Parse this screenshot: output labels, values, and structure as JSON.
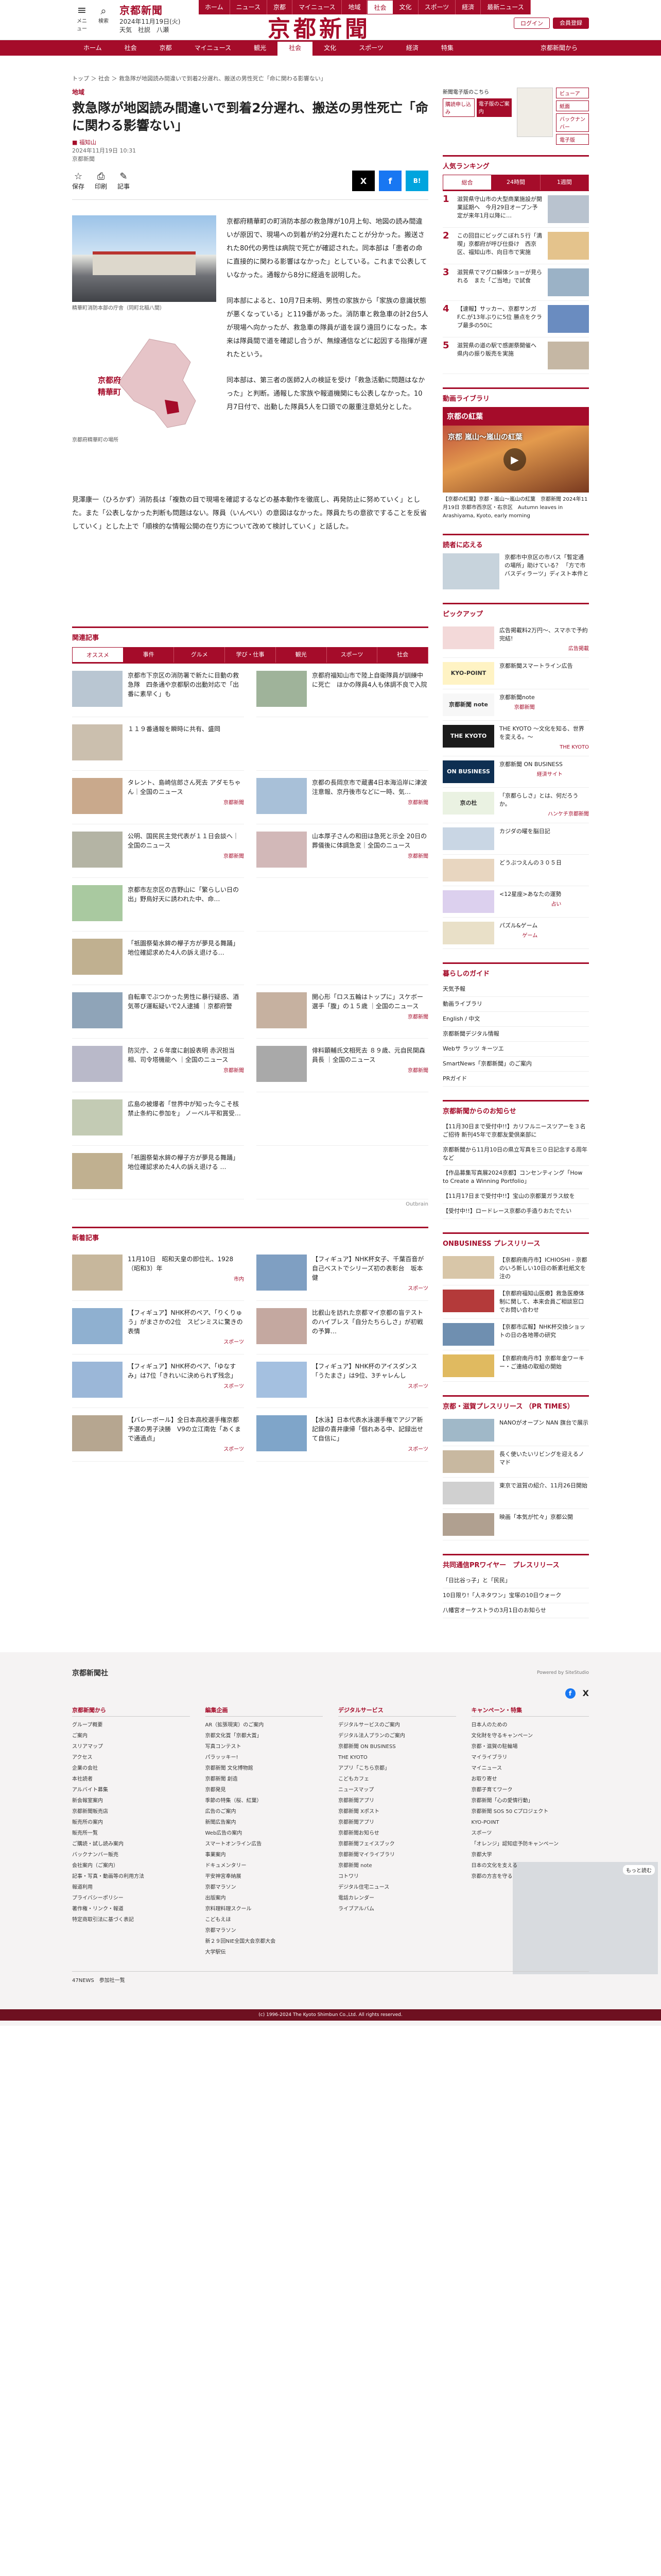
{
  "header": {
    "menu_label": "メニュー",
    "search_label": "検索",
    "small_logo": "京都新聞",
    "date": "2024年11月19日(火)",
    "weather": "天気　社説　八瀬",
    "big_logo": "京都新聞",
    "top_tabs": [
      "ホーム",
      "ニュース",
      "京都",
      "マイニュース",
      "地域",
      "社会",
      "文化",
      "スポーツ",
      "経済",
      "最新ニュース"
    ],
    "active_top_tab": "社会",
    "login": "ログイン",
    "register": "会員登録",
    "newsletter": "京都新聞から"
  },
  "nav2": [
    "ホーム",
    "社会",
    "京都",
    "マイニュース",
    "観光",
    "社会",
    "文化",
    "スポーツ",
    "経済",
    "特集"
  ],
  "nav2_active": "社会",
  "nav2_right": "京都新聞から",
  "breadcrumb": "トップ ＞ 社会 ＞ 救急隊が地図読み間違いで到着2分遅れ、搬送の男性死亡「命に関わる影響ない」",
  "article": {
    "category": "地域",
    "title": "救急隊が地図読み間違いで到着2分遅れ、搬送の男性死亡「命に関わる影響ない」",
    "writer": "■ 福知山",
    "date": "2024年11月19日 10:31",
    "source": "京都新聞",
    "tools": [
      "保存",
      "印刷",
      "記事"
    ],
    "share": [
      "X",
      "f",
      "B!"
    ],
    "photo_caption": "精華町消防本部の庁舎（同町北稲八間）",
    "map_label1": "京都府",
    "map_label2": "精華町",
    "map_caption": "京都府精華町の場所",
    "p1": "京都府精華町の町消防本部の救急隊が10月上旬、地図の読み間違いが原因で、現場への到着が約2分遅れたことが分かった。搬送された80代の男性は病院で死亡が確認された。同本部は「患者の命に直接的に関わる影響はなかった」としている。これまで公表していなかった。通報から8分に経過を説明した。",
    "p2": "同本部によると、10月7日未明、男性の家族から「家族の意識状態が悪くなっている」と119番があった。消防車と救急車の計2台5人が現場へ向かったが、救急車の隊員が道を誤り遠回りになった。本来は隊員間で道を確認し合うが、無線通信などに起因する指揮が遅れたという。",
    "p3": "同本部は、第三者の医師2人の検証を受け「救急活動に問題はなかった」と判断。通報した家族や報道機関にも公表しなかった。10月7日付で、出動した隊員5人を口頭での厳重注意処分とした。",
    "p4": "見澤康一（ひろかず）消防長は「複数の目で現場を確認するなどの基本動作を徹底し、再発防止に努めていく」とした。また「公表しなかった判断も問題はない。隊員（いんぺい）の意図はなかった。隊員たちの意欲ですることを反省していく」とした上で「順検的な情報公開の在り方について改めて検討していく」と話した。"
  },
  "related": {
    "heading": "関連記事",
    "tabs": [
      "オススメ",
      "事件",
      "グルメ",
      "学び・仕事",
      "観光",
      "スポーツ",
      "社会"
    ],
    "items": [
      {
        "text": "京都市下京区の消防署で新たに目動の救急隊　四条通や京都駅の出動対応で「出番に素早く」も",
        "src": ""
      },
      {
        "text": "京都府福知山市で陸上自衛隊員が訓練中に死亡　ほかの隊員4人も体調不良で入院",
        "src": ""
      },
      {
        "text": "１１９番通報を瞬時に共有、盛岡",
        "src": ""
      },
      {
        "text": "",
        "src": ""
      },
      {
        "text": "タレント、島崎信郎さん死去 アダモちゃん｜全国のニュース",
        "src": "京都新聞"
      },
      {
        "text": "京都の長岡京市で蔵書4日本海沿岸に津波注意報、京丹後市などに一時、気…",
        "src": "京都新聞"
      },
      {
        "text": "公明、国民民主党代表が１１日会談へ｜全国のニュース",
        "src": "京都新聞"
      },
      {
        "text": "山本厚子さんの和田は急死と示全 20日の葬儀後に体調急変｜全国のニュース",
        "src": "京都新聞"
      },
      {
        "text": "京都市左京区の吉野山に「繁らしい日の出」野鳥好天に誘われた中、命…",
        "src": ""
      },
      {
        "text": "",
        "src": ""
      },
      {
        "text": "「祇園祭菊水鉾の欅子方が夢見る舞踊」地位確認求めた4人の訴え退ける…",
        "src": ""
      },
      {
        "text": "",
        "src": ""
      },
      {
        "text": "自転車でぶつかった男性に暴行疑惑、酒気帯び運転疑いで2人逮捕 ｜京都府警",
        "src": ""
      },
      {
        "text": "開心形「ロス五輪はトップに」スケボー選手「腹」の１５歳 ｜全国のニュース",
        "src": "京都新聞"
      },
      {
        "text": "防災庁、２６年度に創設表明 赤沢担当相、司令塔機能へ ｜全国のニュース",
        "src": "京都新聞"
      },
      {
        "text": "俳料顕輔氏文相死去 ８９歳、元自民関森員長 ｜全国のニュース",
        "src": "京都新聞"
      },
      {
        "text": "広島の被爆者「世界中が知った今こそ核禁止条約に参加を」 ノーベル平和賞受…",
        "src": ""
      },
      {
        "text": "",
        "src": ""
      },
      {
        "text": "「祇園祭菊水鉾の欅子方が夢見る舞踊」地位確認求めた4人の訴え退ける …",
        "src": ""
      },
      {
        "text": "",
        "src": ""
      }
    ],
    "outbrain": "Outbrain"
  },
  "latest": {
    "heading": "新着記事",
    "items": [
      {
        "text": "11月10日　昭和天皇の即位礼、1928（昭和3）年",
        "src": "市内"
      },
      {
        "text": "【フィギュア】NHK杯女子、千葉百音が自己ベストでシリーズ初の表彰台　坂本健",
        "src": "スポーツ"
      },
      {
        "text": "【フィギュア】NHK杯のペア、「りくりゅう」がまさかの2位　スピンミスに驚きの表情",
        "src": "スポーツ"
      },
      {
        "text": "比叡山を訪れた京都マイ京都の盲テストのハイブレス「自分たちらしさ」が初戦の予算…",
        "src": ""
      },
      {
        "text": "【フィギュア】NHK杯のペア、「ゆなすみ」は7位「きれいに決められず残念」",
        "src": "スポーツ"
      },
      {
        "text": "【フィギュア】NHK杯のアイスダンス「うたまさ」は9位、3チャレんし",
        "src": "スポーツ"
      },
      {
        "text": "【バレーボール】全日本高校選手権京都予選の男子決勝　V9の立江南佐「あくまで通過点」",
        "src": "スポーツ"
      },
      {
        "text": "【水泳】日本代表水泳選手権でアジア新記録の喜井康帰「個れある中、記録出せて自信に」",
        "src": "スポーツ"
      }
    ]
  },
  "side": {
    "paper_btn1": "新聞電子版のこちら",
    "paper_btn2": "購読申し込み",
    "paper_btn3": "電子版のご案内",
    "paper_menu": [
      "ビューア",
      "紙面",
      "バックナンバー",
      "電子版"
    ],
    "ranking": {
      "heading": "人気ランキング",
      "tabs": [
        "総合",
        "24時間",
        "1週間"
      ],
      "items": [
        "滋賀県守山市の大型商業施設が開業延期へ　今月29日オープン予定が来年1月以降に…",
        "この回目にビッグこぼれ５行「満喫」京都府が呼び仕掛け　西京区、福知山市、向日市で実施",
        "滋賀県でマグロ解体ショーが見られる　また「ご当地」で試食",
        "【速報】サッカー、京都サンガF.C.が13年ぶりに5位 勝点をクラブ最多の50に",
        "滋賀県の道の駅で感謝祭開催へ　県内の振り販売を実施"
      ]
    },
    "video": {
      "heading": "動画ライブラリ",
      "title": "京都の紅葉",
      "overlay": "京都 嵐山〜嵐山の紅葉",
      "caption": "【京都の紅葉】京都・嵐山〜嵐山の紅葉　京都新聞 2024年11月19日 京都市西京区・右京区　Autumn leaves in Arashiyama, Kyoto, early morning"
    },
    "survey_heading": "読者に応える",
    "survey_text": "京都市中京区の市バス「暫定通の場所」助けている？ 「方で市バスディラーツ」ディスト本件と",
    "pickup": {
      "heading": "ピックアップ",
      "items": [
        {
          "logo": "",
          "text": "広告掲載料2万円〜、スマホで予約完結!",
          "tag": "広告掲載"
        },
        {
          "logo": "KYO-POINT",
          "text": "京都新聞スマートライン広告",
          "tag": ""
        },
        {
          "logo": "京都新聞 note",
          "text": "京都新聞note",
          "tag": "京都新聞"
        },
        {
          "logo": "THE KYOTO",
          "text": "THE KYOTO ～文化を知る、世界を変える。～",
          "tag": "THE KYOTO"
        },
        {
          "logo": "ON BUSINESS",
          "text": "京都新聞 ON BUSINESS",
          "tag": "経済サイト"
        },
        {
          "logo": "京の杜",
          "text": "「京都らしさ」とは、何だろうか。",
          "tag": "ハンケチ京都新聞"
        },
        {
          "logo": "",
          "text": "カジダの曜を脳日記",
          "tag": ""
        },
        {
          "logo": "",
          "text": "どうぶつえんの３０５日",
          "tag": ""
        },
        {
          "logo": "",
          "text": "<12星座>あなたの運勢",
          "tag": "占い"
        },
        {
          "logo": "",
          "text": "パズル&ゲーム",
          "tag": "ゲーム"
        }
      ]
    },
    "guide": {
      "heading": "暮らしのガイド",
      "items": [
        "天気予報",
        "動画ライブラリ",
        "English / 中文",
        "京都新聞デジタル情報",
        "Webサ ラッツ キーツエ",
        "SmartNews「京都新聞」のご案内",
        "PRガイド"
      ]
    },
    "notices": {
      "heading": "京都新聞からのお知らせ",
      "items": [
        "【11月30日まで受付中!!】カリフルニースツアーを３名ご招待 新刊45年で京都友愛倶楽部に",
        "京都新聞から11月10日の県立写真を三０日記念する周年など",
        "【作品募集写真展2024京都】コンセンティング「How to Create a Winning Portfolio」",
        "【11月17日まで受付中!!】宝山の京都葉ガラス紋を",
        "【受付中!!】ロードレース京都の手造りおたでたい"
      ]
    },
    "onbiz": {
      "heading": "ONBUSINESS プレスリリース",
      "items": [
        "【京都府南丹市】ICHIOSHI - 京都のいろ新しい10日の新素社紙文を注の",
        "【京都府福知山医療】救急医療体制に関して、本来会員ご相談窓口でお問い合わせ",
        "【京都市広報】NHK杯交換ショットの日の各地帯の研究",
        "【京都府南丹市】京都年金ワーキー・ご連絡の取組の開始"
      ]
    },
    "shiga": {
      "heading": "京都・滋賀プレスリリース （PR TIMES）",
      "items": [
        "NANOがオープン NAN 旗台で展示",
        "長く使いたいリビングを迎えるノマド",
        "東京で滋賀の紹介、11月26日開始",
        "映画「本気が忙々」京都公開"
      ]
    },
    "shared_news": {
      "heading": "共同通信PRワイヤー　プレスリリース",
      "items": [
        "「日比谷っ子」と「民民」",
        "10日限り!「人ネタワン」宝塚の10日ウォーク",
        "八幡宮オーケストラの3月1日のお知らせ"
      ]
    },
    "close_label": "もっと読む"
  },
  "footer": {
    "logo": "京都新聞社",
    "powered": "Powered by SiteStudio",
    "columns": [
      {
        "title": "京都新聞から",
        "items": [
          "グループ概要",
          "ご案内",
          "スリアマップ",
          "アクセス",
          "企業の会社",
          "本社読者",
          "アルバイト募集",
          "新会報室案内",
          "京都新聞販売店",
          "販売所の案内",
          "販売所一覧",
          "ご購読・試し読み案内",
          "バックナンバー販売",
          "会社案内（ご案内）",
          "記事・写真・動画等の利用方法",
          "報道利用",
          "プライバシーポリシー",
          "著作権・リンク・報道",
          "特定商取引法に基づく表記"
        ]
      },
      {
        "title": "編集企画",
        "items": [
          "AR（拡張現実）のご案内",
          "京都文化賞「京都大賞」",
          "写真コンテスト",
          "パラッッキー!",
          "京都新聞 文化博物館",
          "京都新聞 創造",
          "京都発見",
          "季節の特集（桜、紅葉）",
          "広告のご案内",
          "新聞広告案内",
          "Web広告の案内",
          "スマートオンライン広告",
          "事業案内",
          "ドキュメンタリー",
          "平安神宮奉納展",
          "京都マラソン",
          "出版案内",
          "京料理料理スクール",
          "こどもえほ",
          "京都マラソン",
          "新２９回NIE全国大会京都大会",
          "大学駅伝"
        ]
      },
      {
        "title": "デジタルサービス",
        "items": [
          "デジタルサービスのご案内",
          "デジタル法人プランのご案内",
          "京都新聞 ON BUSINESS",
          "THE KYOTO",
          "アプリ「こちら京都」",
          "こどもカフェ",
          "ニュースマップ",
          "京都新聞アプリ",
          "京都新聞 Xポスト",
          "京都新聞アプリ",
          "京都新聞お知らせ",
          "京都新聞フェイスブック",
          "京都新聞マイライブラリ",
          "京都新聞 note",
          "コトワリ",
          "デジタル住宅ニュース",
          "電話カレンダー",
          "ライブアルバム"
        ]
      },
      {
        "title": "キャンペーン・特集",
        "items": [
          "日本人のための",
          "文化財を守るキャンペーン",
          "京都・滋賀の駐輪場",
          "マイライブラリ",
          "マイニュース",
          "お取り寄せ",
          "京都子育てワーク",
          "京都新聞「心の愛情行動」",
          "京都新聞 SOS 50 Cプロジェクト",
          "KYO-POINT",
          "スポーツ",
          "「オレンジ」認知症予防キャンペーン",
          "京都大学",
          "日本の文化を支える",
          "京都の方言を守る"
        ]
      }
    ],
    "network": "47NEWS　参加社一覧",
    "copyright": "(c) 1996-2024 The Kyoto Shimbun Co.,Ltd. All rights reserved."
  }
}
